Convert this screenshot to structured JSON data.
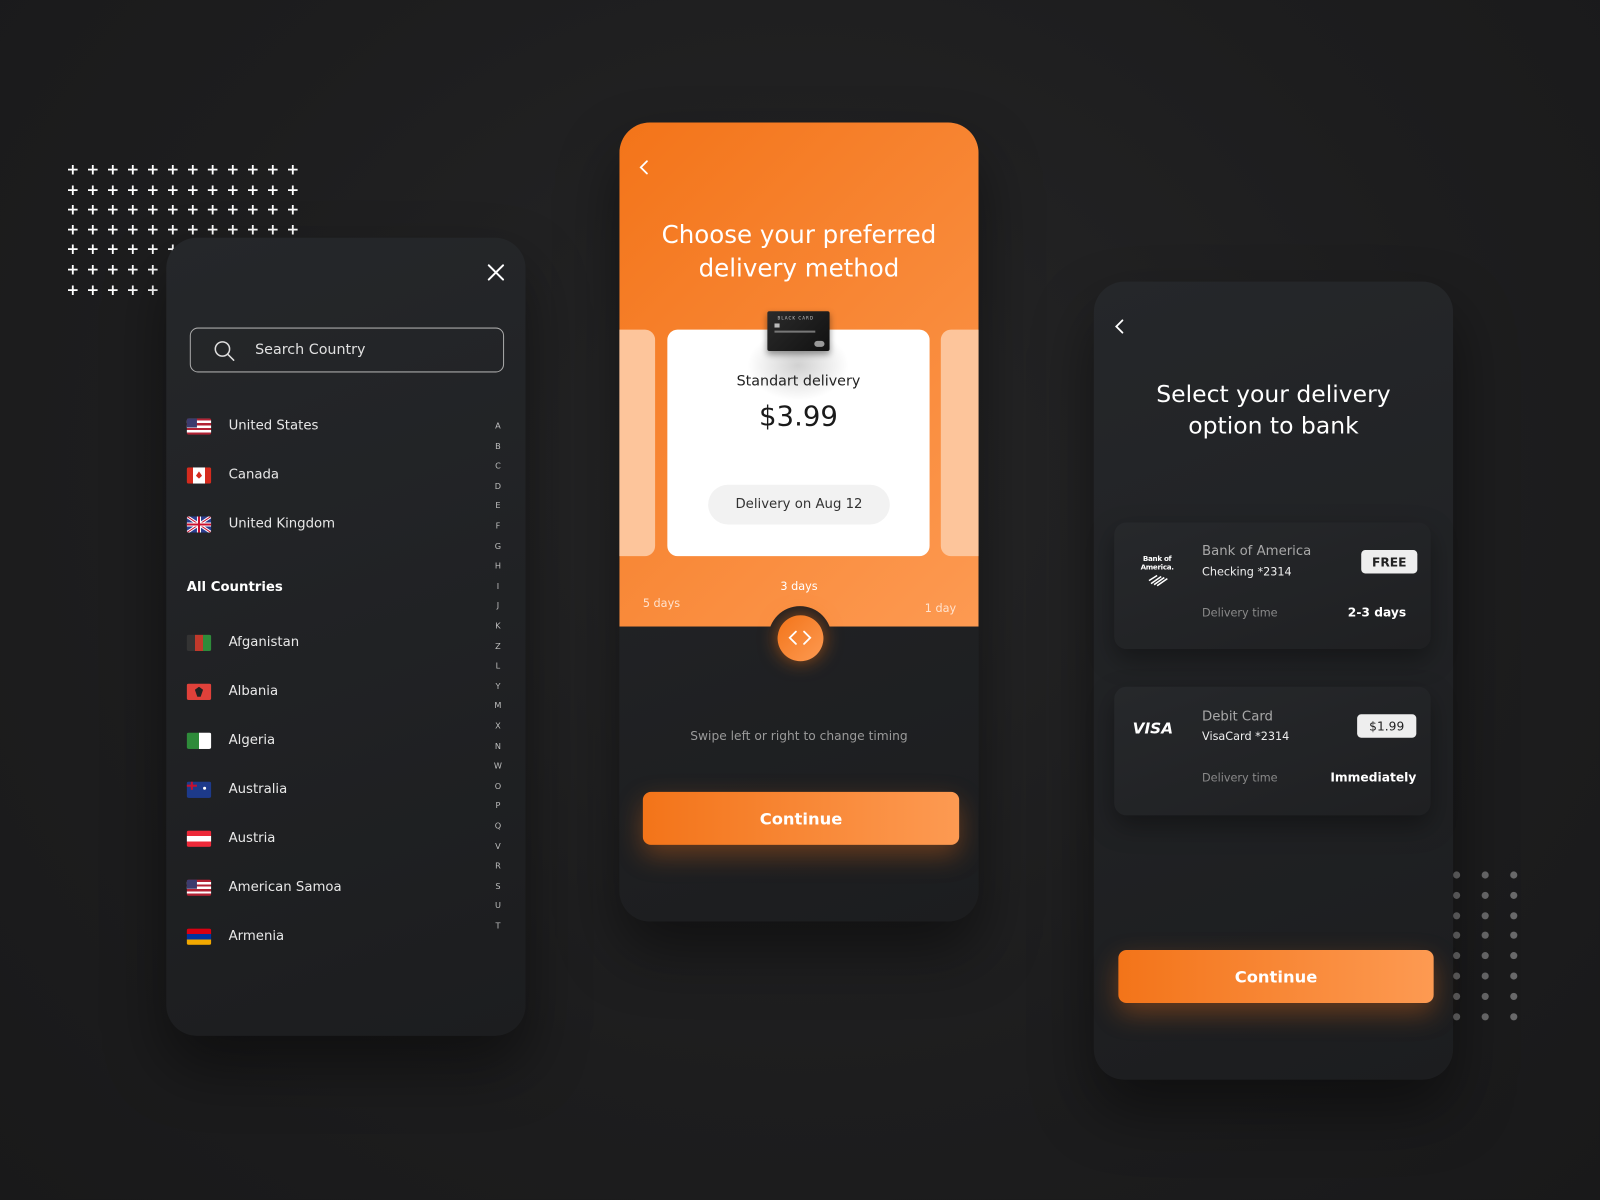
{
  "country_panel": {
    "close_icon": "close-icon",
    "search": {
      "placeholder": "Search Country",
      "value": ""
    },
    "top_countries": [
      {
        "name": "United States",
        "flag": "us"
      },
      {
        "name": "Canada",
        "flag": "ca"
      },
      {
        "name": "United Kingdom",
        "flag": "gb"
      }
    ],
    "all_countries_label": "All Countries",
    "countries": [
      {
        "name": "Afganistan",
        "flag": "af"
      },
      {
        "name": "Albania",
        "flag": "al"
      },
      {
        "name": "Algeria",
        "flag": "dz"
      },
      {
        "name": "Australia",
        "flag": "au"
      },
      {
        "name": "Austria",
        "flag": "at"
      },
      {
        "name": "American Samoa",
        "flag": "as"
      },
      {
        "name": "Armenia",
        "flag": "am"
      }
    ],
    "alphabet": [
      "A",
      "B",
      "C",
      "D",
      "E",
      "F",
      "G",
      "H",
      "I",
      "J",
      "K",
      "Z",
      "L",
      "Y",
      "M",
      "X",
      "N",
      "W",
      "O",
      "P",
      "Q",
      "V",
      "R",
      "S",
      "U",
      "T"
    ]
  },
  "delivery_panel": {
    "title_line1": "Choose your preferred",
    "title_line2": "delivery method",
    "card": {
      "image_text": "BLACK CARD",
      "name": "Standart delivery",
      "price": "$3.99",
      "delivery_date": "Delivery on Aug 12"
    },
    "timings": {
      "left": "5 days",
      "center": "3 days",
      "right": "1 day"
    },
    "hint": "Swipe left or right to change timing",
    "continue_label": "Continue"
  },
  "bank_panel": {
    "title_line1": "Select your delivery",
    "title_line2": "option to bank",
    "options": [
      {
        "logo": "Bank of America.",
        "name": "Bank of America",
        "account": "Checking *2314",
        "price": "FREE",
        "delivery_label": "Delivery time",
        "delivery_value": "2-3 days"
      },
      {
        "logo": "VISA",
        "name": "Debit Card",
        "account": "VisaCard *2314",
        "price": "$1.99",
        "delivery_label": "Delivery time",
        "delivery_value": "Immediately"
      }
    ],
    "continue_label": "Continue"
  },
  "colors": {
    "accent": "#f37419",
    "accent_light": "#fd9a52",
    "background": "#1c1c1d",
    "panel": "#222427"
  }
}
